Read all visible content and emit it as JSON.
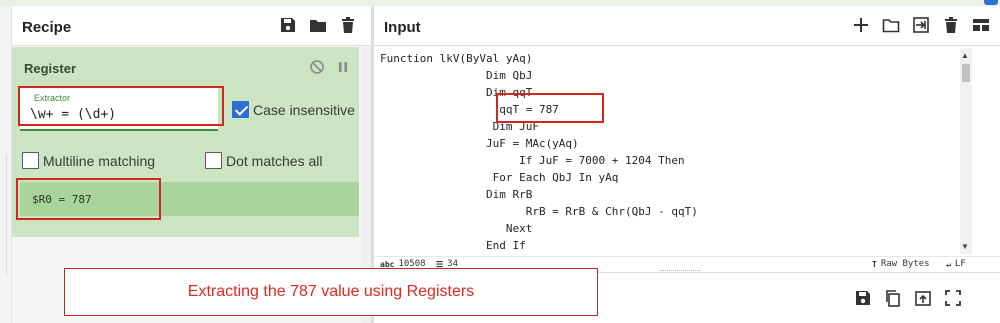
{
  "recipe": {
    "title": "Recipe",
    "operation": {
      "title": "Register",
      "extractor_label": "Extractor",
      "extractor_value": "\\w+ = (\\d+)",
      "case_insensitive_label": "Case insensitive",
      "case_insensitive_checked": true,
      "multiline_label": "Multiline matching",
      "multiline_checked": false,
      "dotall_label": "Dot matches all",
      "dotall_checked": false,
      "output": "$R0 = 787"
    }
  },
  "input": {
    "title": "Input",
    "lines": [
      "Function lkV(ByVal yAq)",
      "                Dim QbJ",
      "                Dim qqT",
      "                  qqT = 787",
      "                 Dim JuF",
      "                JuF = MAc(yAq)",
      "                     If JuF = 7000 + 1204 Then",
      "                 For Each QbJ In yAq",
      "                Dim RrB",
      "                      RrB = RrB & Chr(QbJ - qqT)",
      "                   Next",
      "                End If"
    ],
    "status": {
      "length_icon": "abc",
      "length": "10508",
      "lines": "34",
      "raw_bytes": "Raw Bytes",
      "eol": "LF"
    }
  },
  "caption": "Extracting the 787 value using Registers",
  "colors": {
    "operation_bg": "#cbe4c2",
    "output_bg": "#a9d49b",
    "highlight": "#d0281f",
    "checkbox_blue": "#2f6fcf"
  }
}
